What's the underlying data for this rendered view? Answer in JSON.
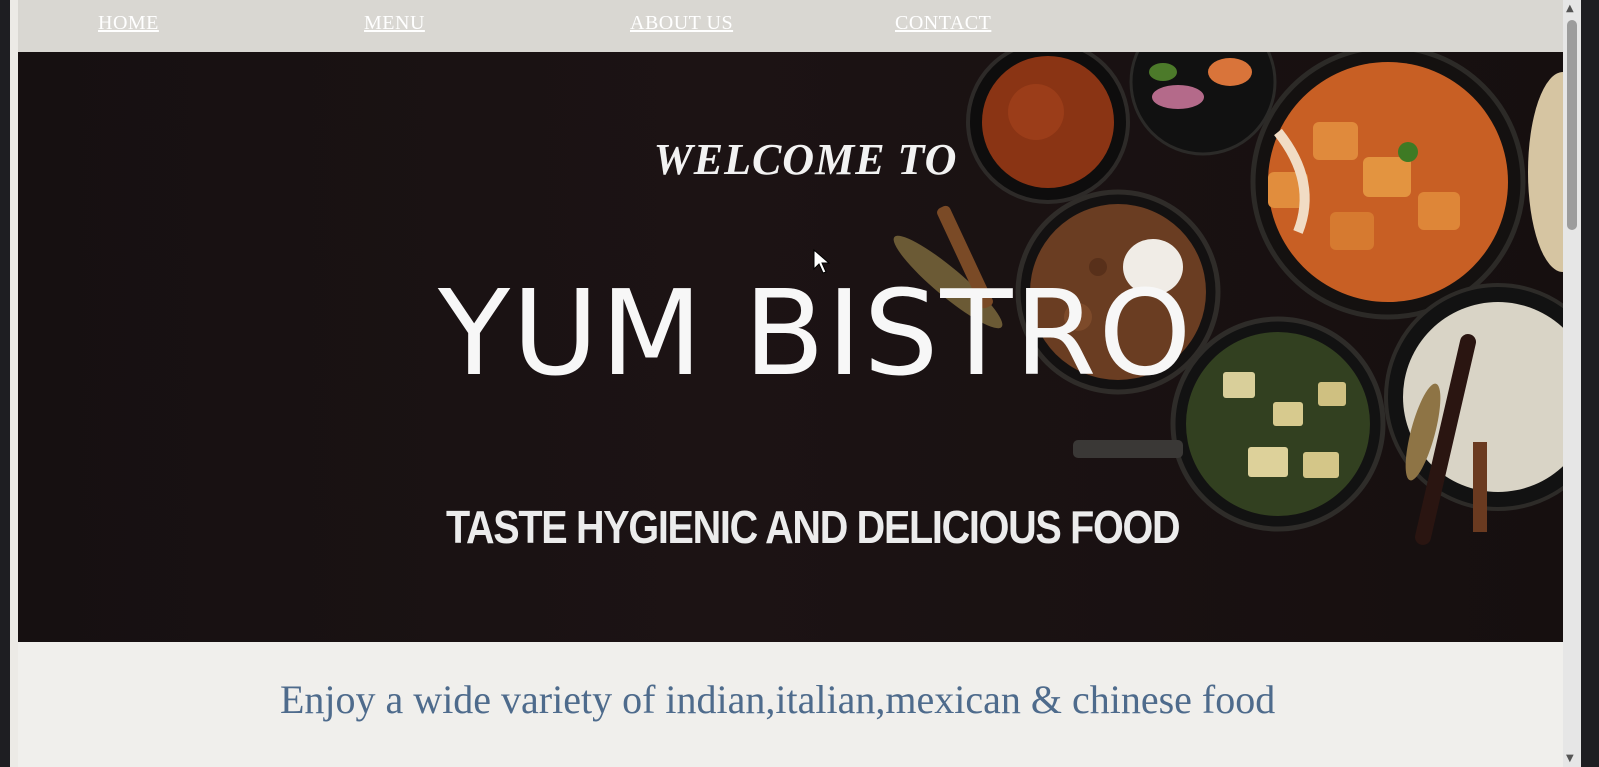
{
  "nav": {
    "items": [
      {
        "label": "HOME"
      },
      {
        "label": "MENU"
      },
      {
        "label": "ABOUT US"
      },
      {
        "label": "CONTACT"
      }
    ]
  },
  "hero": {
    "welcome": "WELCOME TO",
    "title": "YUM BISTRO",
    "tagline": "TASTE HYGIENIC AND DELICIOUS FOOD"
  },
  "main": {
    "subtitle": "Enjoy a wide variety of indian,italian,mexican & chinese food"
  },
  "colors": {
    "hero_background": "#1a1213",
    "nav_background": "#d9d7d2",
    "subtitle_text": "#4e6b8c"
  },
  "icons": {
    "cursor": "mouse-pointer-icon"
  }
}
